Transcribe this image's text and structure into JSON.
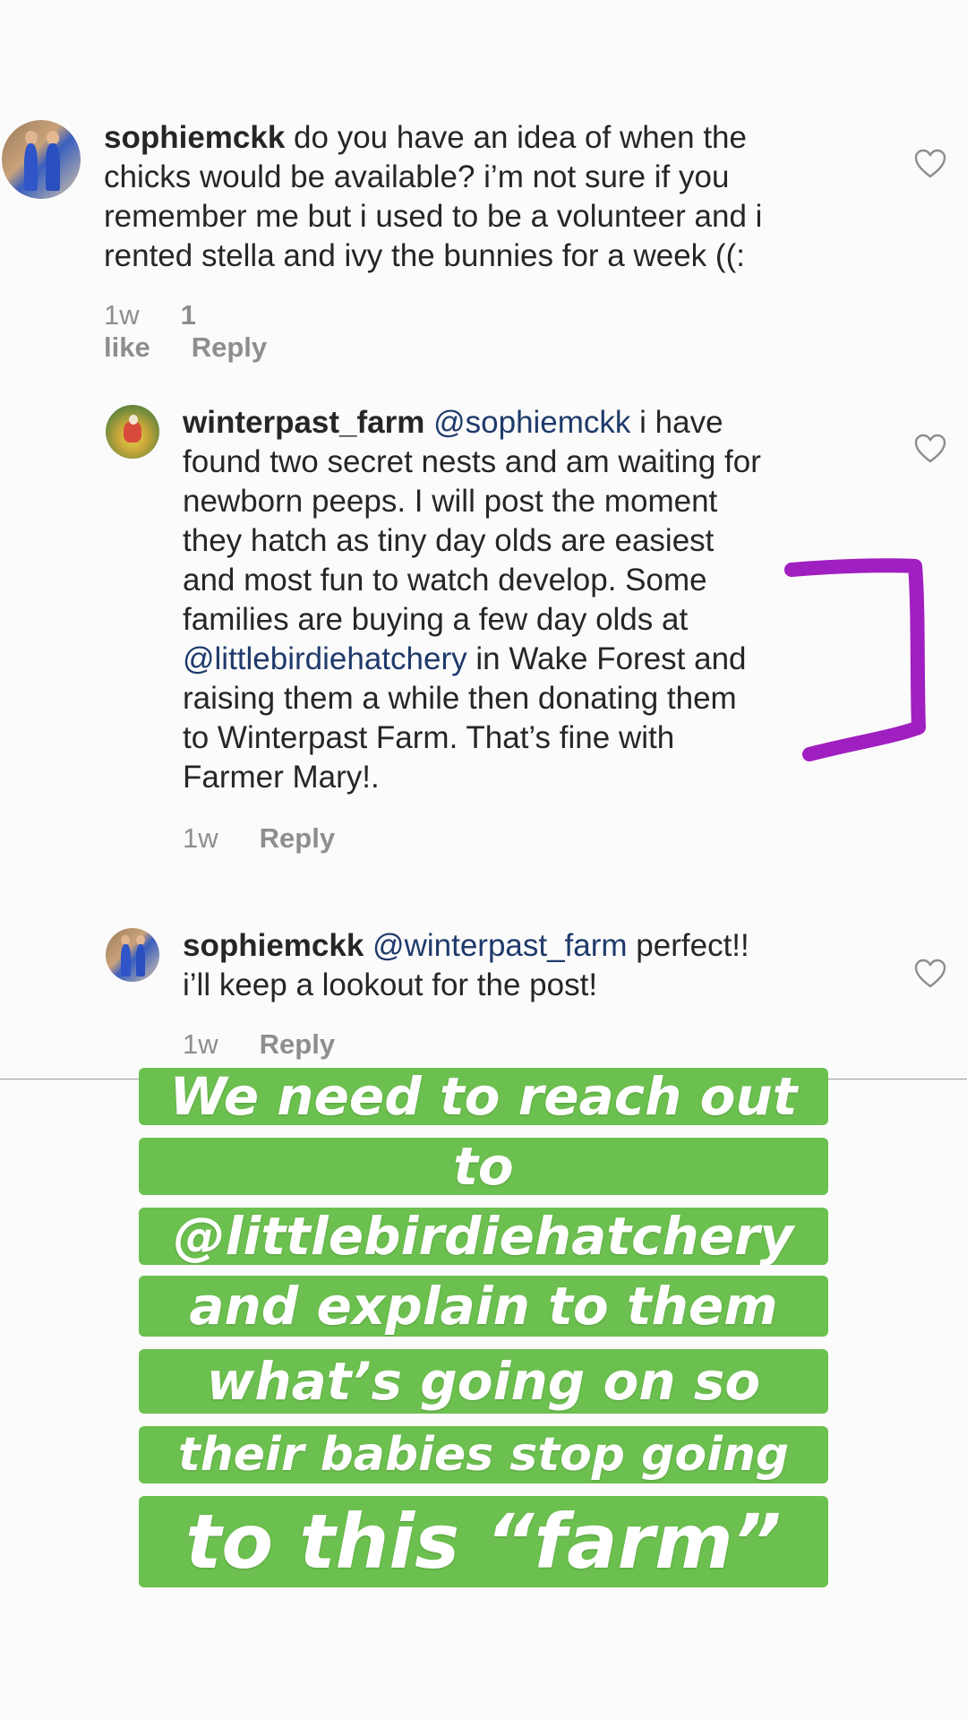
{
  "comments": [
    {
      "username": "sophiemckk",
      "mention": "",
      "body": "do you have an idea of when the",
      "lines": [
        "chicks would be available? i’m not sure if you",
        "remember me but i used to be a volunteer and i",
        "rented stella and ivy the bunnies for a week ((:"
      ],
      "time": "1w",
      "likes": "1 like",
      "reply": "Reply"
    },
    {
      "username": "winterpast_farm",
      "mention": "@sophiemckk",
      "first_line_rest": "i have",
      "lines": [
        "found two secret nests and am waiting for",
        "newborn peeps. I will post the moment",
        "they hatch as tiny day olds  are easiest",
        "and most fun to watch develop. Some",
        "families are buying a few day olds at"
      ],
      "mention2": "@littlebirdiehatchery",
      "mention2_rest": " in Wake Forest and",
      "lines2": [
        "raising them a while then donating them",
        "to Winterpast Farm. That’s fine with",
        "Farmer Mary!."
      ],
      "time": "1w",
      "reply": "Reply"
    },
    {
      "username": "sophiemckk",
      "mention": "@winterpast_farm",
      "first_line_rest": "perfect!!",
      "lines": [
        "i’ll keep a lookout for the post!"
      ],
      "time": "1w",
      "reply": "Reply"
    }
  ],
  "overlay_lines": [
    "We need to reach out",
    "to",
    "@littlebirdiehatchery",
    "and explain to them",
    "what’s going on so",
    "their babies stop going",
    "to this “farm”"
  ],
  "colors": {
    "overlay_green": "#6cc04f",
    "bracket_purple": "#a01fc0",
    "mention_blue": "#1f3a6b",
    "meta_gray": "#8e8e8e"
  },
  "icons": [
    "heart-icon",
    "heart-icon",
    "heart-icon"
  ]
}
